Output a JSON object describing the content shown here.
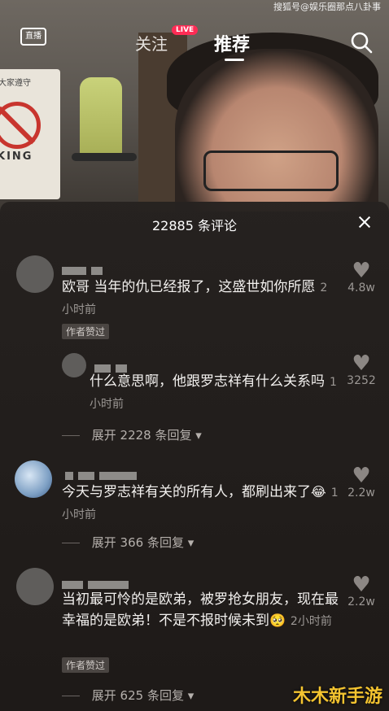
{
  "watermark_top": "搜狐号@娱乐圈那点八卦事",
  "nav": {
    "live_label": "直播",
    "follow": "关注",
    "live_badge": "LIVE",
    "recommend": "推荐"
  },
  "background_sign": {
    "top_text": "大家遵守",
    "bottom_text": "KING"
  },
  "comments_panel": {
    "title": "22885 条评论",
    "comments": [
      {
        "text": "欧哥 当年的仇已经报了，这盛世如你所愿",
        "time": "2小时前",
        "author_liked": "作者赞过",
        "likes": "4.8w"
      },
      {
        "text": "什么意思啊，他跟罗志祥有什么关系吗",
        "time": "1小时前",
        "likes": "3252",
        "expand": "展开 2228 条回复"
      },
      {
        "text": "今天与罗志祥有关的所有人，都刷出来了",
        "emoji": "😂",
        "time": "1小时前",
        "likes": "2.2w",
        "expand": "展开 366 条回复"
      },
      {
        "text": "当初最可怜的是欧弟，被罗抢女朋友，现在最幸福的是欧弟！不是不报时候未到",
        "emoji": "🥺",
        "time": "2小时前",
        "author_liked": "作者赞过",
        "likes": "2.2w",
        "expand": "展开 625 条回复"
      }
    ]
  },
  "site_watermark": "木木新手游",
  "colors": {
    "live_badge": "#fe2c55",
    "panel_bg": "#26221f",
    "muted": "#9b9794",
    "site_watermark": "#f4c430"
  },
  "icons": [
    "tv-icon",
    "search-icon",
    "close-icon",
    "heart-icon",
    "dropdown-caret-icon"
  ]
}
